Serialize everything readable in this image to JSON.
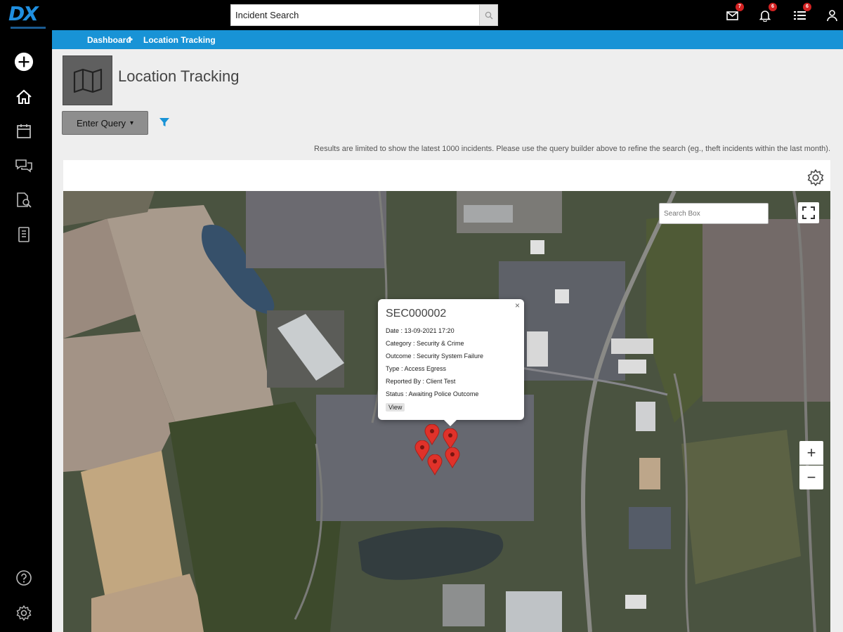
{
  "app": {
    "logo_text": "DX"
  },
  "header": {
    "search_value": "Incident Search",
    "badges": {
      "mail": "7",
      "notifications": "6",
      "tasks": "6"
    }
  },
  "breadcrumb": {
    "home": "Dashboard",
    "separator": ">",
    "current": "Location Tracking"
  },
  "page": {
    "title": "Location Tracking",
    "query_button": "Enter Query",
    "query_caret": "▾",
    "results_note": "Results are limited to show the latest 1000 incidents. Please use the query builder above to refine the search (eg., theft incidents within the last month)."
  },
  "map": {
    "search_placeholder": "Search Box",
    "zoom_in": "+",
    "zoom_out": "−",
    "pin_color": "#e0322a"
  },
  "popup": {
    "title": "SEC000002",
    "close": "×",
    "rows": [
      "Date : 13-09-2021 17:20",
      "Category : Security & Crime",
      "Outcome : Security System Failure",
      "Type : Access Egress",
      "Reported By : Client Test",
      "Status : Awaiting Police Outcome"
    ],
    "view_label": "View"
  },
  "colors": {
    "accent": "#1893d6",
    "badge": "#d32222"
  }
}
